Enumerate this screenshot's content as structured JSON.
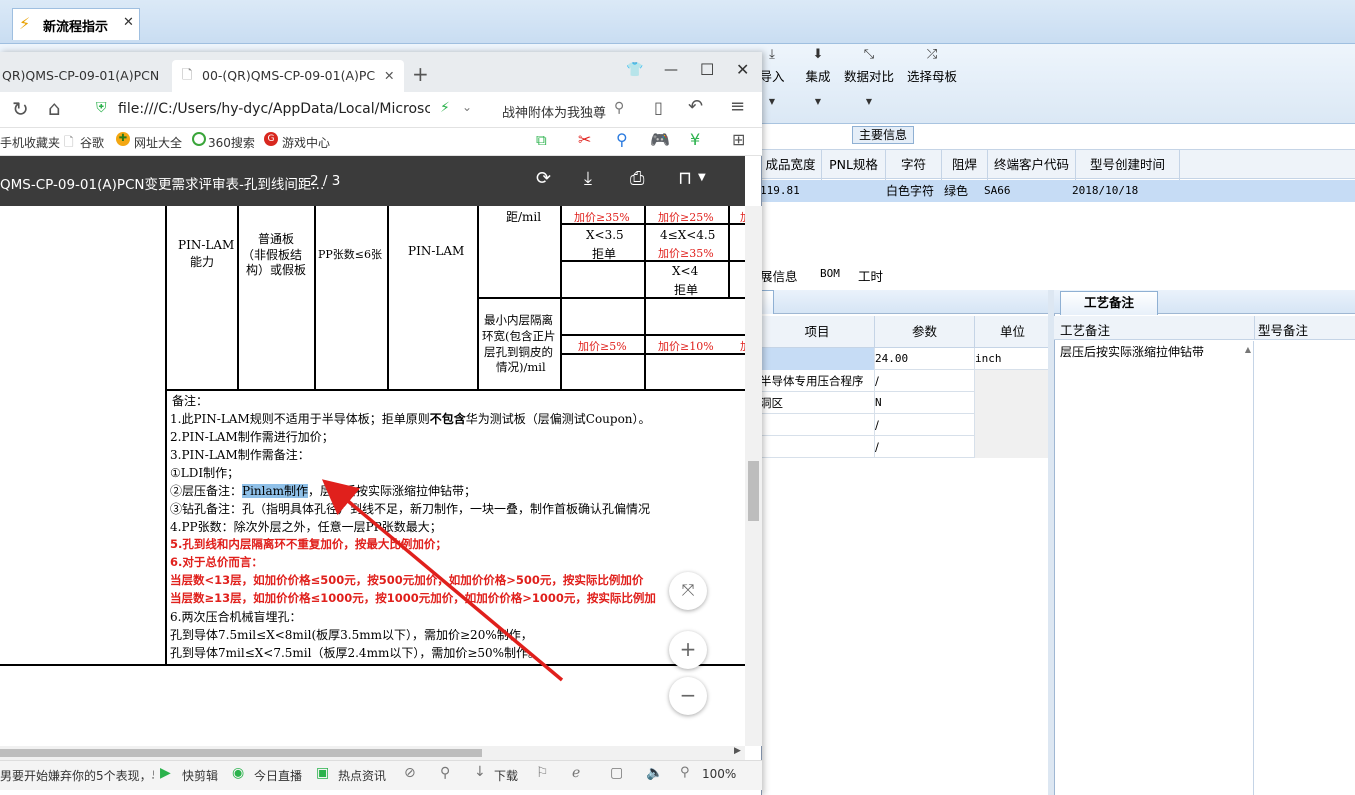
{
  "app": {
    "tab_title": "新流程指示",
    "toolbar": [
      {
        "label": "导入",
        "icon": "import-icon"
      },
      {
        "label": "集成",
        "icon": "integrate-icon"
      },
      {
        "label": "数据对比",
        "icon": "compare-icon"
      },
      {
        "label": "选择母板",
        "icon": "shuffle-icon"
      }
    ],
    "main_info_tab": "主要信息",
    "grid": {
      "columns": [
        "成品宽度",
        "PNL规格",
        "字符",
        "阻焊",
        "终端客户代码",
        "型号创建时间"
      ],
      "row": {
        "width": "119.81",
        "char": "白色字符",
        "mask": "绿色",
        "customer": "SA66",
        "created": "2018/10/18"
      }
    },
    "lower_tabs": [
      "展信息",
      "BOM",
      "工时"
    ],
    "params": {
      "columns": [
        "项目",
        "参数",
        "单位"
      ],
      "rows": [
        {
          "item": "",
          "value": "24.00",
          "unit": "inch"
        },
        {
          "item": "半导体专用压合程序",
          "value": "/",
          "unit": ""
        },
        {
          "item": "洞区",
          "value": "N",
          "unit": ""
        },
        {
          "item": "",
          "value": "/",
          "unit": ""
        },
        {
          "item": "",
          "value": "/",
          "unit": ""
        }
      ]
    },
    "right_panel": {
      "tab": "工艺备注",
      "columns": [
        "工艺备注",
        "型号备注"
      ],
      "note": "层压后按实际涨缩拉伸钻带"
    }
  },
  "browser": {
    "tab1_title": "QR)QMS-CP-09-01(A)PCN",
    "tab2_title": "00-(QR)QMS-CP-09-01(A)PCN",
    "address": "file:///C:/Users/hy-dyc/AppData/Local/Microsc",
    "search_hint": "战神附体为我独尊",
    "bookmarks": [
      "手机收藏夹",
      "谷歌",
      "网址大全",
      "360搜索",
      "游戏中心"
    ],
    "pdf": {
      "title": "QMS-CP-09-01(A)PCN变更需求评审表-孔到线间距...",
      "page": "2 / 3",
      "table": {
        "c1": "PIN-LAM\n能力",
        "c2a": "普通板",
        "c2b": "（非假板结",
        "c2c": "构）或假板",
        "c3": "PP张数≤6张",
        "c4": "PIN-LAM",
        "c5a": "距/mil",
        "r1a": "加价≥35%",
        "r1b": "加价≥25%",
        "r2a1": "X<3.5",
        "r2a2": "拒单",
        "r2b1": "4≤X<4.5",
        "r2b2": "加价≥35%",
        "r3b1": "X<4",
        "r3b2": "拒单",
        "c5b1": "最小内层隔离",
        "c5b2": "环宽(包含正片",
        "c5b3": "层孔到铜皮的",
        "c5b4": "情况)/mil",
        "r4a": "加价≥5%",
        "r4b": "加价≥10%"
      },
      "notes": {
        "head": "备注：",
        "n1a": "1.此PIN-LAM规则不适用于半导体板；拒单原则",
        "n1b": "不包含",
        "n1c": "华为测试板（层偏测试Coupon）。",
        "n2": "2.PIN-LAM制作需进行加价；",
        "n3": "3.PIN-LAM制作需备注：",
        "n3a": "①LDI制作；",
        "n3b_pre": "②层压备注：",
        "n3b_hl": "Pinlam制作",
        "n3b_post": "，层压后按实际涨缩拉伸钻带；",
        "n3c": "③钻孔备注：孔（指明具体孔径）到线不足，新刀制作，一块一叠，制作首板确认孔偏情况",
        "n4": "4.PP张数：除次外层之外，任意一层PP张数最大；",
        "n5": "5.孔到线和内层隔离环不重复加价，按最大比例加价；",
        "n6": "6.对于总价而言：",
        "n6a": "当层数<13层，如加价价格≤500元，按500元加价，如加价价格>500元，按实际比例加价",
        "n6b": "当层数≥13层，如加价价格≤1000元，按1000元加价，如加价价格>1000元，按实际比例加",
        "n7": "6.两次压合机械盲埋孔：",
        "n7a": "孔到导体7.5mil≤X<8mil(板厚3.5mm以下），需加价≥20%制作，",
        "n7b": "孔到导体7mil≤X<7.5mil（板厚2.4mm以下），需加价≥50%制作。"
      }
    },
    "status": {
      "news": "男要开始嫌弃你的5个表现，早",
      "items": [
        "快剪辑",
        "今日直播",
        "热点资讯",
        "下载"
      ],
      "zoom": "100%"
    }
  },
  "colors": {
    "annotation_arrow": "#e0201c",
    "selection": "#8fc0e8",
    "row_selected": "#c6dcf5"
  }
}
